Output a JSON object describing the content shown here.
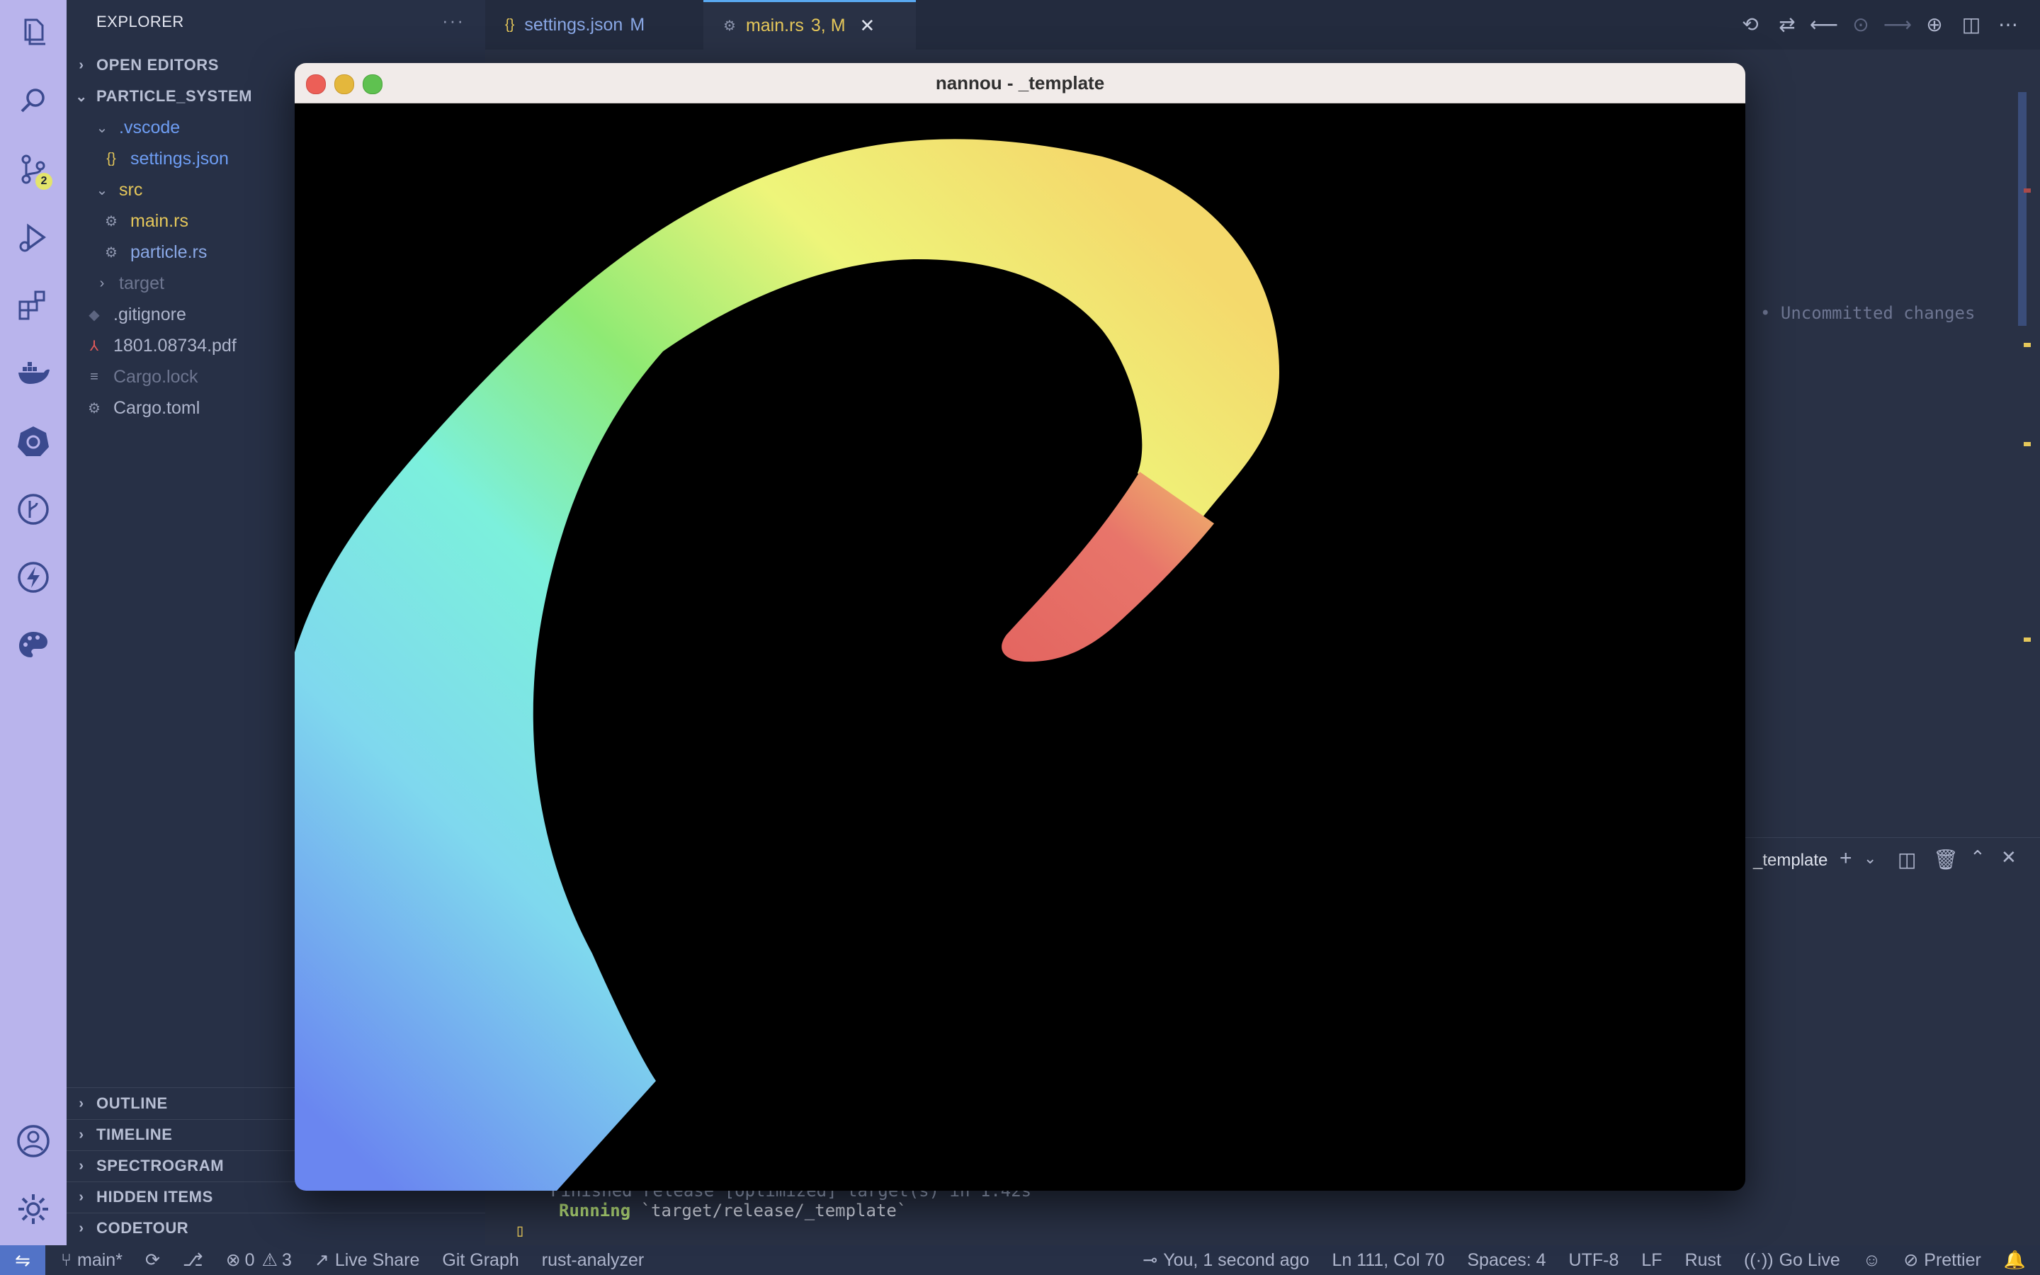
{
  "activity": {
    "scm_badge": "2"
  },
  "sidebar": {
    "title": "EXPLORER",
    "more": "···",
    "open_editors": "OPEN EDITORS",
    "project": "PARTICLE_SYSTEM",
    "tree": [
      {
        "label": "",
        "color": ""
      },
      {
        "label": ".vscode",
        "color": "#6e9df3"
      },
      {
        "label": "settings.json",
        "color": "#6e9df3"
      },
      {
        "label": "src",
        "color": "#e5c75a"
      },
      {
        "label": "main.rs",
        "color": "#e5c75a"
      },
      {
        "label": "particle.rs",
        "color": "#8aa8e6"
      },
      {
        "label": "target",
        "color": "#6e7690"
      },
      {
        "label": ".gitignore",
        "color": "#aeb5cc"
      },
      {
        "label": "1801.08734.pdf",
        "color": "#aeb5cc"
      },
      {
        "label": "Cargo.lock",
        "color": "#6e7690"
      },
      {
        "label": "Cargo.toml",
        "color": "#aeb5cc"
      }
    ],
    "bottom_sections": [
      "OUTLINE",
      "TIMELINE",
      "SPECTROGRAM",
      "HIDDEN ITEMS",
      "CODETOUR"
    ]
  },
  "tabs": [
    {
      "label": "settings.json",
      "status": "M"
    },
    {
      "label": "main.rs",
      "status": "3, M"
    }
  ],
  "editor": {
    "inline_blame": "• Uncommitted changes"
  },
  "panel": {
    "terminal_name": "_template",
    "finished_line": "Finished release [optimized] target(s) in 1.42s",
    "running_keyword": "Running",
    "running_path": "`target/release/_template`",
    "cursor": "▯"
  },
  "status": {
    "branch": "main*",
    "errors": "0",
    "warnings": "3",
    "live_share": "Live Share",
    "git_graph": "Git Graph",
    "rust_analyzer": "rust-analyzer",
    "blame": "You, 1 second ago",
    "position": "Ln 111, Col 70",
    "spaces": "Spaces: 4",
    "encoding": "UTF-8",
    "eol": "LF",
    "language": "Rust",
    "go_live": "Go Live",
    "prettier": "Prettier"
  },
  "window": {
    "title": "nannou - _template"
  }
}
